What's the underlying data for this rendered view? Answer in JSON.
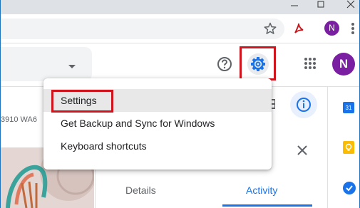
{
  "browser": {
    "profile_initial": "N",
    "extension_icon": "pdf-icon"
  },
  "gmail_header": {
    "profile_initial": "N"
  },
  "left_pane": {
    "partial_text": "3910 WA6"
  },
  "side_panel": {
    "calendar_day": "31"
  },
  "detail_tabs": [
    {
      "label": "Details"
    },
    {
      "label": "Activity"
    }
  ],
  "settings_menu": {
    "items": [
      {
        "label": "Settings"
      },
      {
        "label": "Get Backup and Sync for Windows"
      },
      {
        "label": "Keyboard shortcuts"
      }
    ]
  },
  "colors": {
    "highlight": "#d0141d",
    "accent": "#1a73e8",
    "avatar": "#7b1fa2"
  }
}
